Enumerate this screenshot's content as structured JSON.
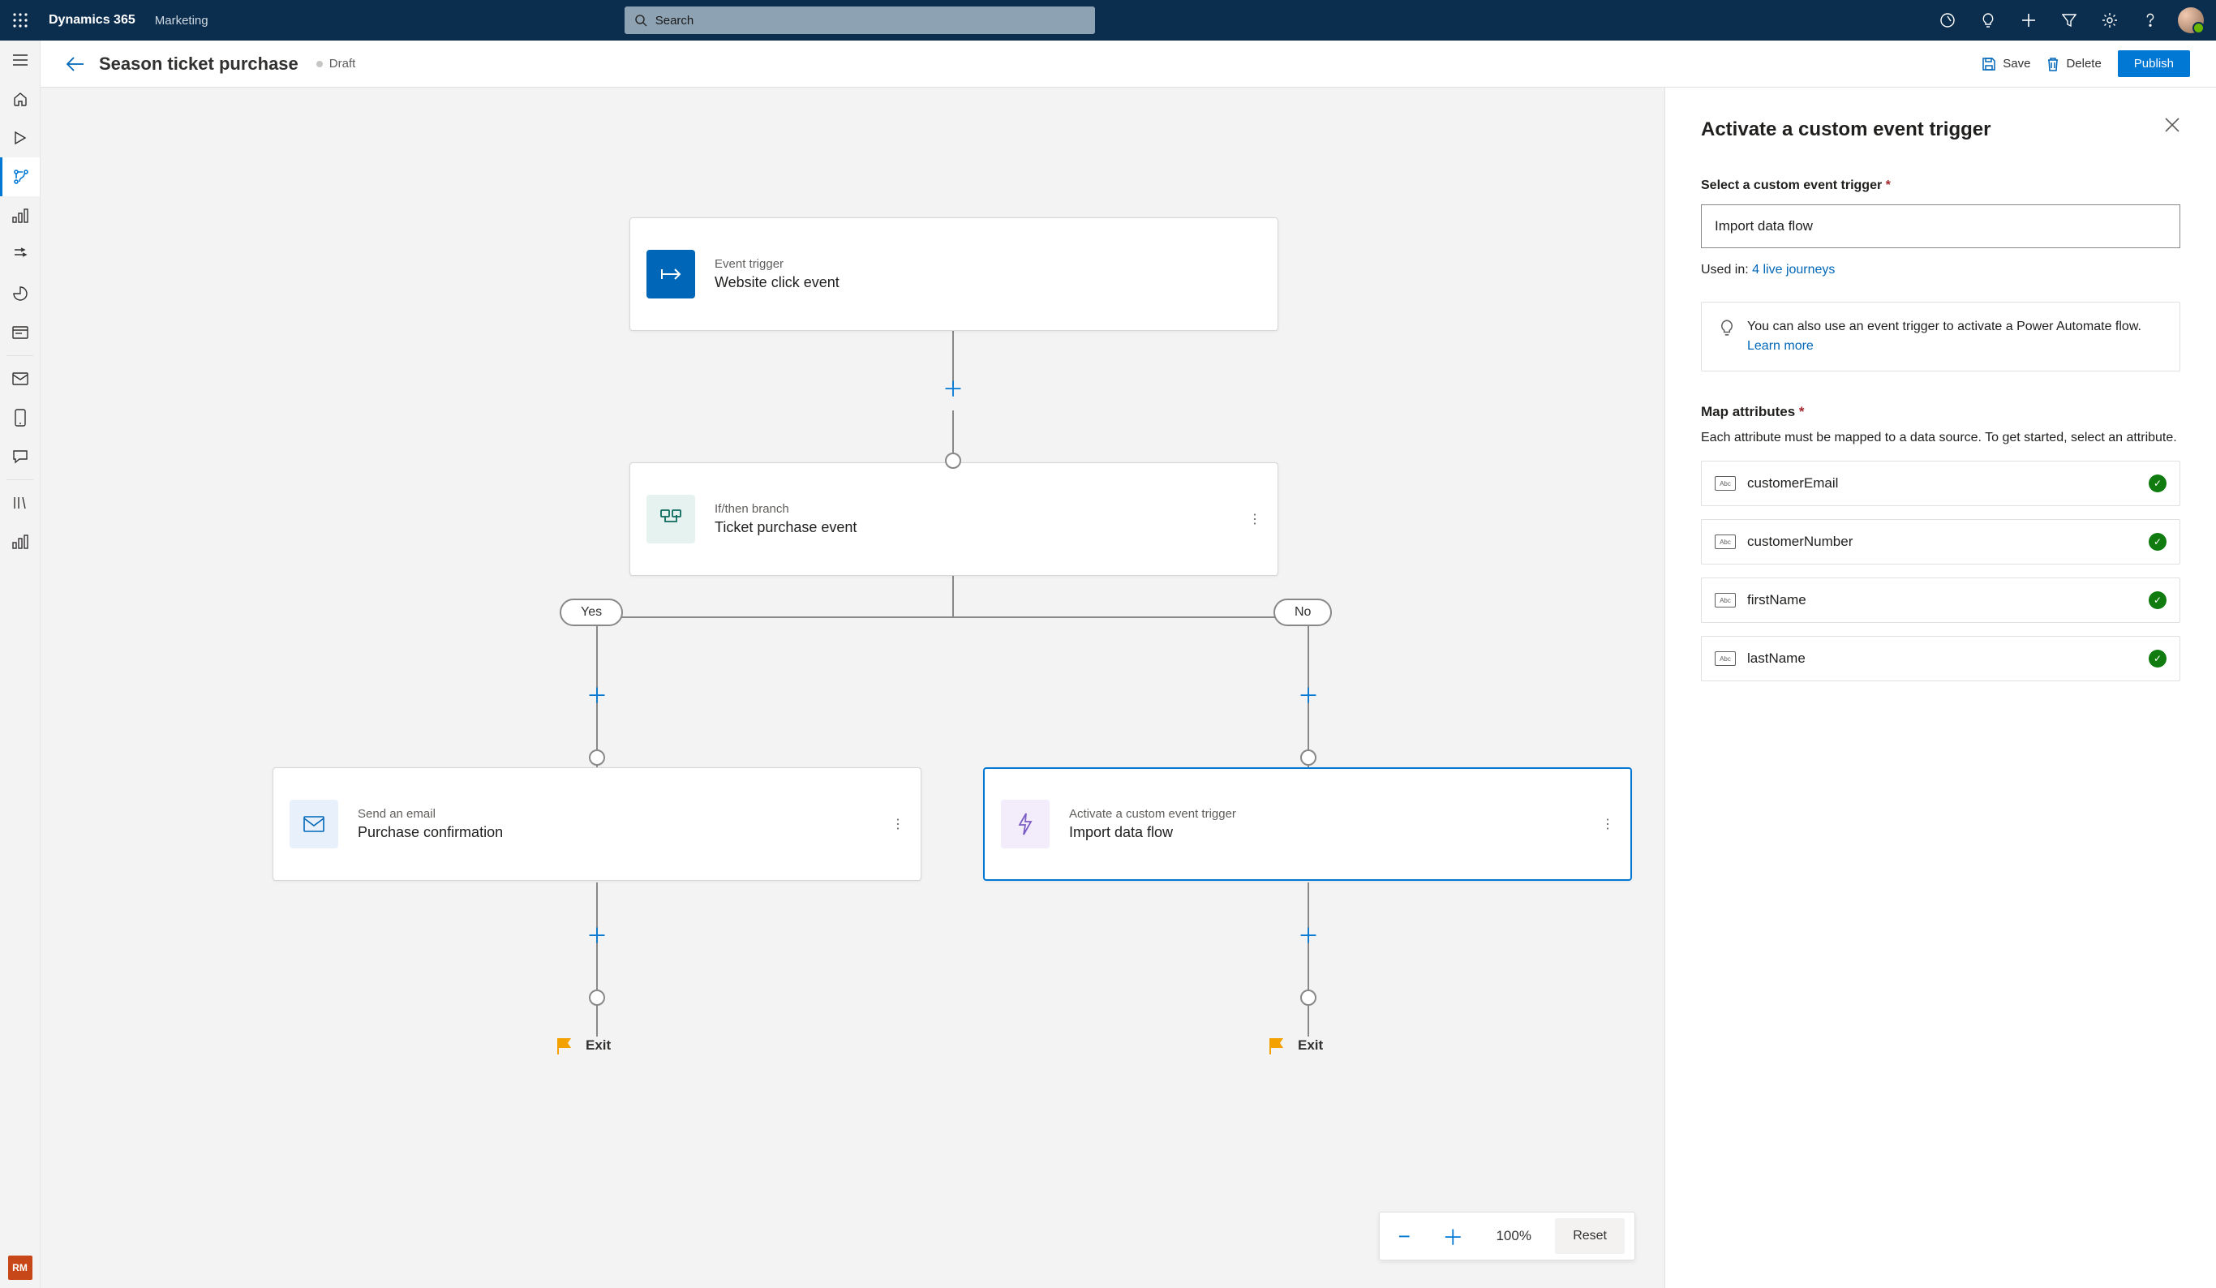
{
  "topbar": {
    "brand": "Dynamics 365",
    "area": "Marketing",
    "search_placeholder": "Search"
  },
  "rail": {
    "rm": "RM"
  },
  "cmdbar": {
    "title": "Season ticket purchase",
    "status": "Draft",
    "save": "Save",
    "delete": "Delete",
    "publish": "Publish"
  },
  "canvas": {
    "trigger": {
      "kicker": "Event trigger",
      "title": "Website click event"
    },
    "branch": {
      "kicker": "If/then branch",
      "title": "Ticket purchase event"
    },
    "yes": "Yes",
    "no": "No",
    "emailCard": {
      "kicker": "Send an email",
      "title": "Purchase confirmation"
    },
    "customCard": {
      "kicker": "Activate a custom event trigger",
      "title": "Import data flow"
    },
    "exit": "Exit",
    "zoom": {
      "level": "100%",
      "reset": "Reset"
    }
  },
  "panel": {
    "title": "Activate a custom event trigger",
    "selectLabel": "Select a custom event trigger",
    "inputValue": "Import data flow",
    "usedInPrefix": "Used in: ",
    "usedInLink": "4 live journeys",
    "tipText": "You can also use an event trigger to activate a Power Automate flow.",
    "tipLink": "Learn more",
    "mapLabel": "Map attributes",
    "mapHelp": "Each attribute must be mapped to a data source. To get started, select an attribute.",
    "attrs": [
      "customerEmail",
      "customerNumber",
      "firstName",
      "lastName"
    ]
  }
}
